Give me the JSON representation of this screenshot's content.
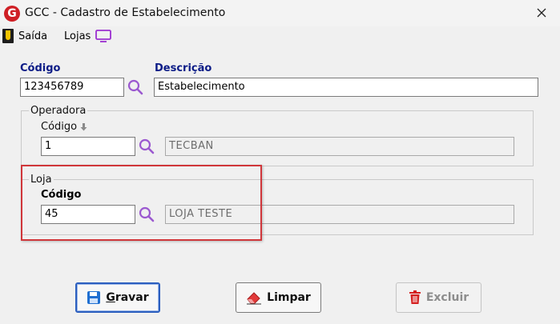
{
  "window": {
    "title": "GCC - Cadastro de Estabelecimento",
    "app_icon_letter": "G"
  },
  "menu": {
    "saida": "Saída",
    "lojas": "Lojas"
  },
  "estabelecimento": {
    "codigo_label": "Código",
    "codigo_value": "123456789",
    "descricao_label": "Descrição",
    "descricao_value": "Estabelecimento"
  },
  "operadora": {
    "group_title": "Operadora",
    "codigo_label": "Código",
    "codigo_value": "1",
    "nome_value": "TECBAN"
  },
  "loja": {
    "group_title": "Loja",
    "codigo_label": "Código",
    "codigo_value": "45",
    "nome_value": "LOJA TESTE"
  },
  "buttons": {
    "gravar_first": "G",
    "gravar_rest": "ravar",
    "limpar": "Limpar",
    "excluir": "Excluir"
  },
  "colors": {
    "label_blue": "#0b1b86",
    "highlight_red": "#d0363a",
    "search_icon": "#9b59d0"
  }
}
